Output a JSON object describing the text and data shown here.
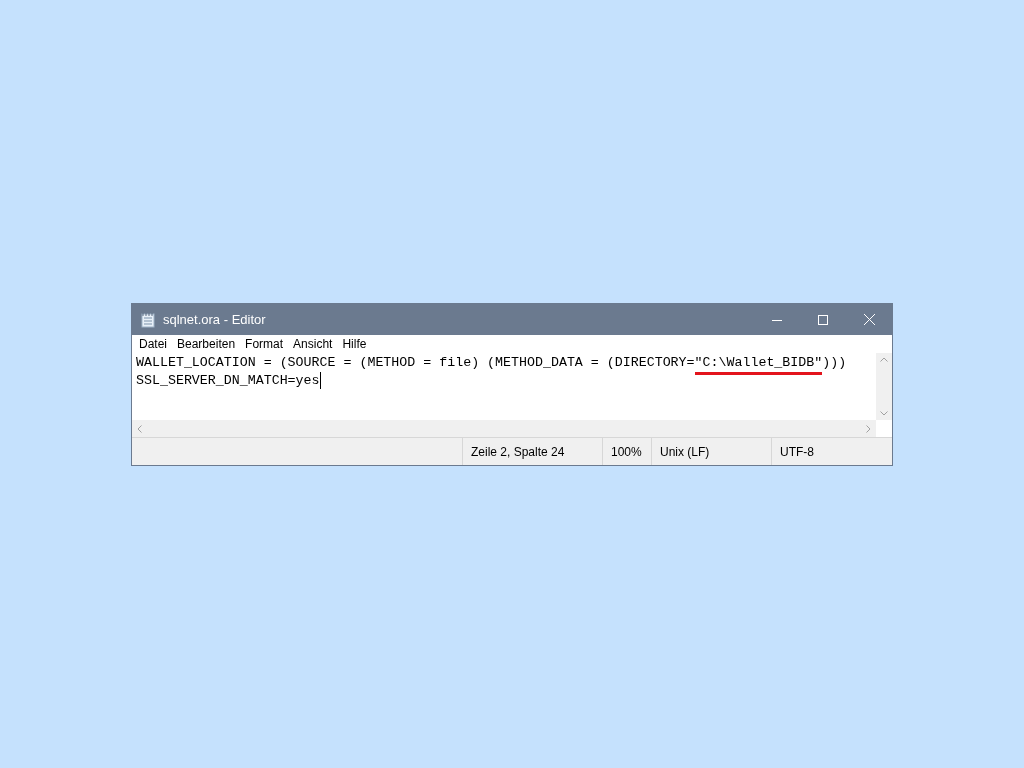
{
  "window": {
    "title": "sqlnet.ora - Editor"
  },
  "menu": [
    "Datei",
    "Bearbeiten",
    "Format",
    "Ansicht",
    "Hilfe"
  ],
  "lines": [
    [
      {
        "text": "WALLET_LOCATION = (SOURCE = (METHOD = file) (METHOD_DATA = (DIRECTORY=",
        "underlined": false
      },
      {
        "text": "\"C:\\Wallet_BIDB\"",
        "underlined": true
      },
      {
        "text": ")))",
        "underlined": false
      }
    ],
    [
      {
        "text": "SSL_SERVER_DN_MATCH=yes",
        "underlined": false
      }
    ]
  ],
  "status_bar": [
    "Zeile 2, Spalte 24",
    "100%",
    "Unix (LF)",
    "UTF-8"
  ]
}
